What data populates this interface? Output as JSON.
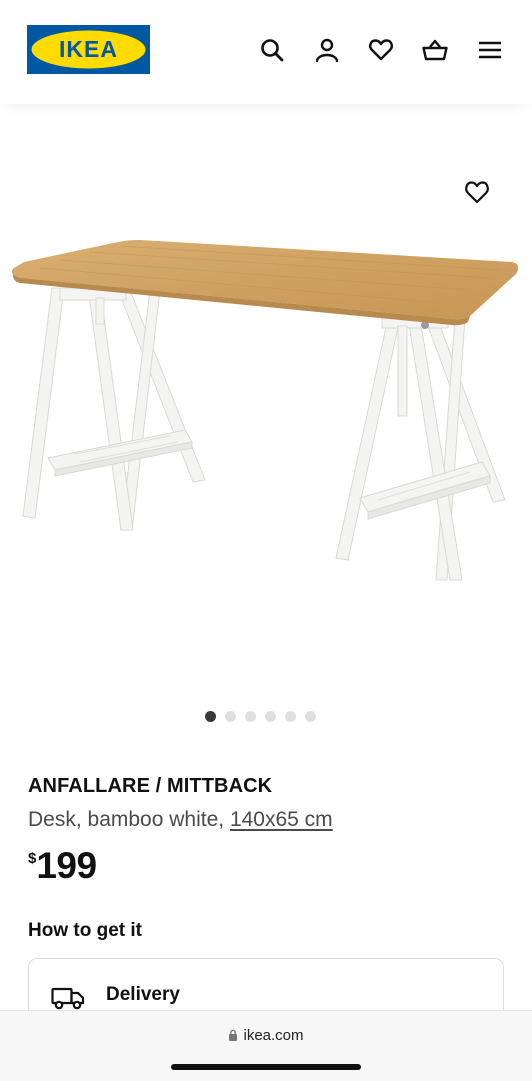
{
  "header": {
    "logo_text": "IKEA",
    "brand_colors": {
      "blue": "#0058a3",
      "yellow": "#ffdb00"
    },
    "icons": [
      "search-icon",
      "account-icon",
      "heart-icon",
      "basket-icon",
      "menu-icon"
    ]
  },
  "gallery": {
    "image_count": 6,
    "active_index": 0,
    "favorite_icon": "heart-icon"
  },
  "product": {
    "name": "ANFALLARE / MITTBACK",
    "description": "Desk, bamboo white,",
    "dimensions": "140x65 cm",
    "currency": "$",
    "price": "199"
  },
  "availability": {
    "heading": "How to get it",
    "delivery_label": "Delivery",
    "delivery_icon": "truck-icon"
  },
  "browser": {
    "url": "ikea.com",
    "lock_icon": "lock-icon"
  }
}
